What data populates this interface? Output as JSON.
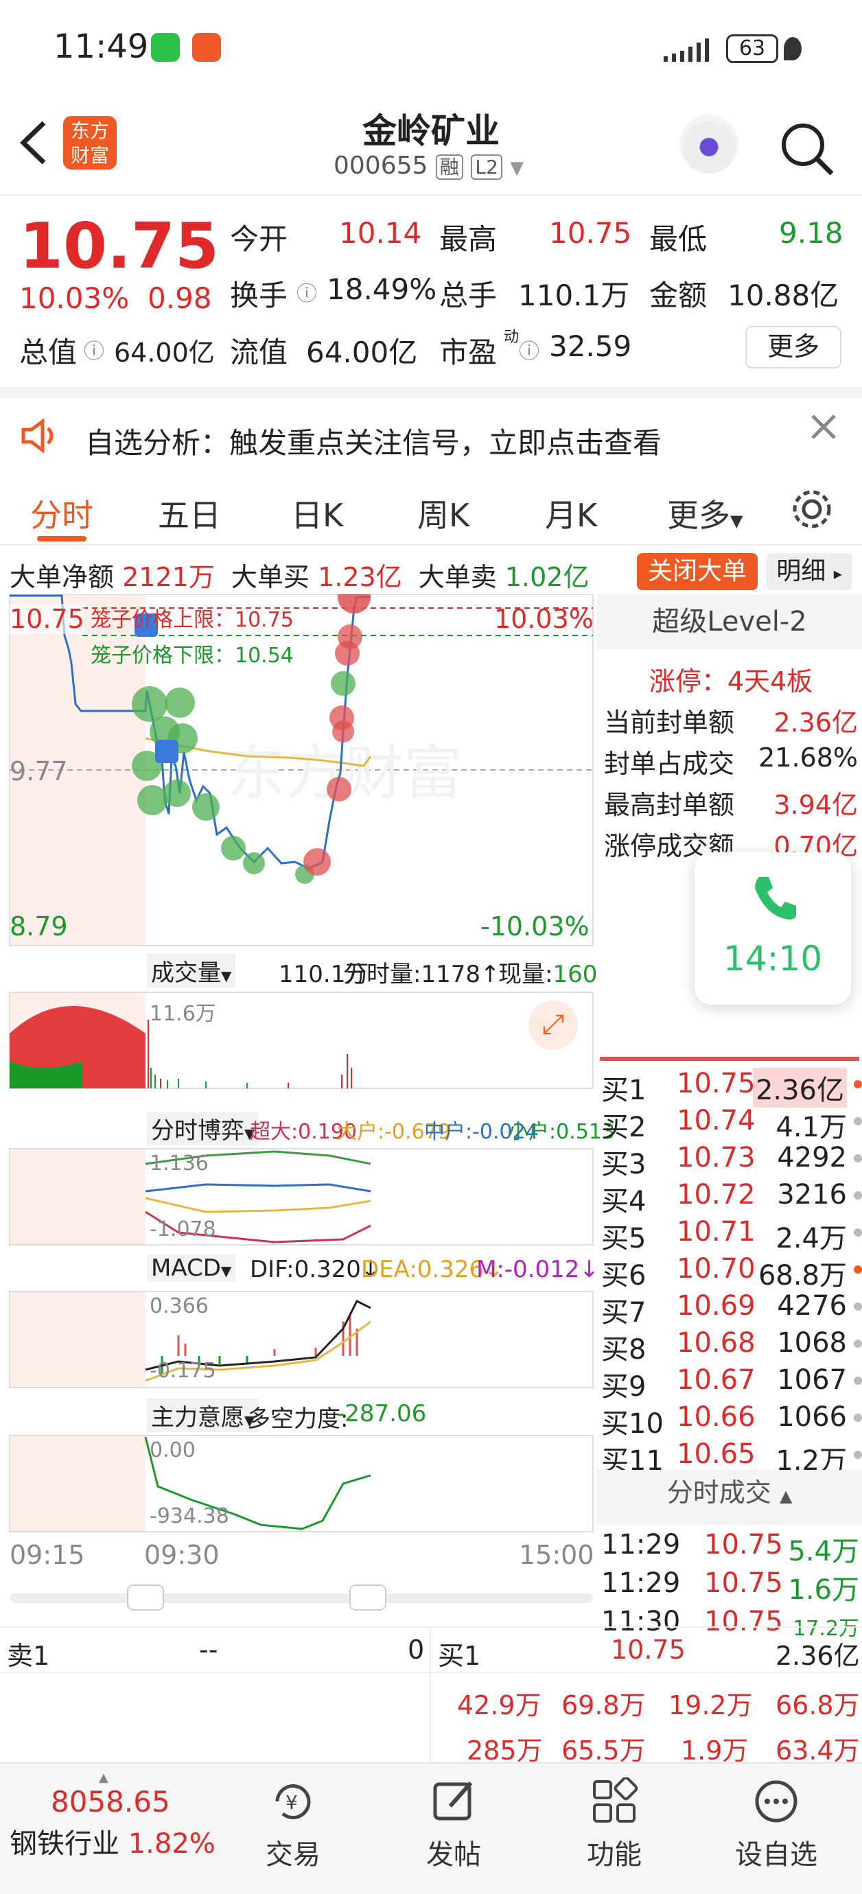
{
  "status": {
    "time": "11:49",
    "battery": "63"
  },
  "header": {
    "title": "金岭矿业",
    "code": "000655",
    "tag1": "融",
    "tag2": "L2",
    "brand_line1": "东方",
    "brand_line2": "财富"
  },
  "quote": {
    "price": "10.75",
    "change_pct": "10.03%",
    "change_amt": "0.98",
    "open_label": "今开",
    "open": "10.14",
    "high_label": "最高",
    "high": "10.75",
    "low_label": "最低",
    "low": "9.18",
    "turnover_label": "换手",
    "turnover": "18.49%",
    "volume_label": "总手",
    "volume": "110.1万",
    "amount_label": "金额",
    "amount": "10.88亿",
    "mktcap_label": "总值",
    "mktcap": "64.00亿",
    "float_label": "流值",
    "float": "64.00亿",
    "pe_label": "市盈",
    "pe_sup": "动",
    "pe": "32.59",
    "more": "更多"
  },
  "notice": {
    "text": "自选分析：触发重点关注信号，立即点击查看"
  },
  "tabs": [
    "分时",
    "五日",
    "日K",
    "周K",
    "月K",
    "更多"
  ],
  "bigorder": {
    "net_label": "大单净额",
    "net": "2121万",
    "buy_label": "大单买",
    "buy": "1.23亿",
    "sell_label": "大单卖",
    "sell": "1.02亿",
    "close_btn": "关闭大单",
    "detail_btn": "明细"
  },
  "chart": {
    "top_price": "10.75",
    "top_pct": "10.03%",
    "mid_price": "9.77",
    "bot_price": "8.79",
    "bot_pct": "-10.03%",
    "cage_up": "笼子价格上限：10.75",
    "cage_down": "笼子价格下限：10.54",
    "watermark": "东方财富",
    "vol_label": "成交量",
    "vol_total": "110.1万",
    "vol_tick": "分时量:1178↑",
    "vol_now_label": "现量:",
    "vol_now": "160",
    "vol_max": "11.6万",
    "game_label": "分时博弈",
    "super": "超大:0.190",
    "large": "大户:-0.679",
    "mid": "中户:-0.024",
    "small": "小户:0.513",
    "game_max": "1.136",
    "game_min": "-1.078",
    "macd_label": "MACD",
    "dif": "DIF:0.320↓",
    "dea": "DEA:0.326↓",
    "m": "M:-0.012↓",
    "macd_max": "0.366",
    "macd_min": "-0.175",
    "zl_label": "主力意愿",
    "dk_label": "多空力度:",
    "dk": "-287.06",
    "zl_max": "0.00",
    "zl_min": "-934.38",
    "t0": "09:15",
    "t1": "09:30",
    "t2": "15:00"
  },
  "level2": {
    "title": "超级Level-2",
    "limit": "涨停：4天4板",
    "rows": [
      {
        "k": "当前封单额",
        "v": "2.36亿"
      },
      {
        "k": "封单占成交",
        "v": "21.68%"
      },
      {
        "k": "最高封单额",
        "v": "3.94亿"
      },
      {
        "k": "涨停成交额",
        "v": "0.70亿"
      }
    ],
    "call_time": "14:10",
    "bids": [
      {
        "n": "买1",
        "p": "10.75",
        "q": "2.36亿"
      },
      {
        "n": "买2",
        "p": "10.74",
        "q": "4.1万"
      },
      {
        "n": "买3",
        "p": "10.73",
        "q": "4292"
      },
      {
        "n": "买4",
        "p": "10.72",
        "q": "3216"
      },
      {
        "n": "买5",
        "p": "10.71",
        "q": "2.4万"
      },
      {
        "n": "买6",
        "p": "10.70",
        "q": "68.8万"
      },
      {
        "n": "买7",
        "p": "10.69",
        "q": "4276"
      },
      {
        "n": "买8",
        "p": "10.68",
        "q": "1068"
      },
      {
        "n": "买9",
        "p": "10.67",
        "q": "1067"
      },
      {
        "n": "买10",
        "p": "10.66",
        "q": "1066"
      },
      {
        "n": "买11",
        "p": "10.65",
        "q": "1.2万"
      }
    ],
    "trades_title": "分时成交",
    "trades": [
      {
        "t": "11:29",
        "p": "10.75",
        "v": "5.4万"
      },
      {
        "t": "11:29",
        "p": "10.75",
        "v": "1.6万"
      },
      {
        "t": "11:30",
        "p": "10.75",
        "v": "17.2万"
      }
    ]
  },
  "bottom": {
    "sell1_label": "卖1",
    "sell1_price": "--",
    "sell1_qty": "0",
    "buy1_label": "买1",
    "buy1_price": "10.75",
    "buy1_qty": "2.36亿",
    "q1": [
      "42.9万",
      "69.8万",
      "19.2万",
      "66.8万"
    ],
    "q2": [
      "285万",
      "65.5万",
      "1.9万",
      "63.4万"
    ]
  },
  "nav": {
    "index_value": "8058.65",
    "index_name": "钢铁行业",
    "index_pct": "1.82%",
    "items": [
      "交易",
      "发帖",
      "功能",
      "设自选"
    ]
  }
}
